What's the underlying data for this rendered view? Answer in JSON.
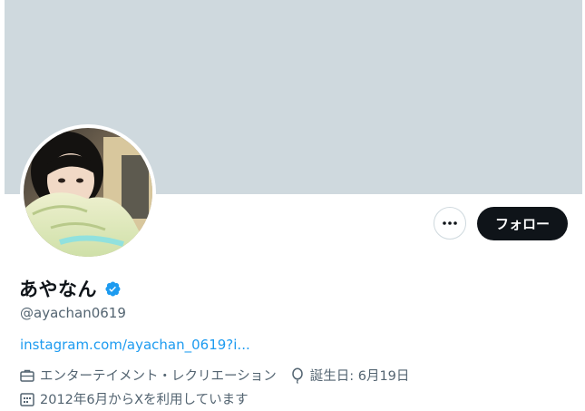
{
  "profile": {
    "display_name": "あやなん",
    "handle": "@ayachan0619",
    "link": "instagram.com/ayachan_0619?i...",
    "category": "エンターテイメント・レクリエーション",
    "birthday": "誕生日: 6月19日",
    "joined": "2012年6月からXを利用しています"
  },
  "actions": {
    "follow_label": "フォロー",
    "more_icon": "more-horizontal-icon"
  },
  "colors": {
    "banner": "#cfd9de",
    "verified": "#1d9bf0",
    "link": "#1d9bf0",
    "button_bg": "#0f1419",
    "secondary_text": "#536471"
  },
  "icons": {
    "verified": "verified-badge-icon",
    "category": "briefcase-icon",
    "birthday": "balloon-icon",
    "joined": "calendar-icon"
  }
}
